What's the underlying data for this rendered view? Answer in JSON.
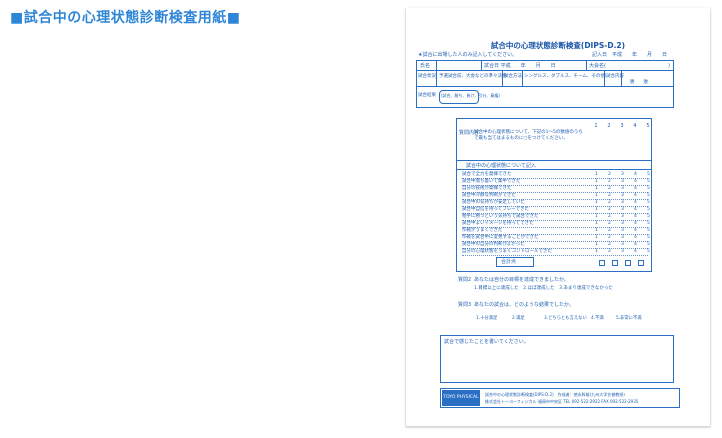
{
  "page": {
    "heading": "■試合中の心理状態診断検査用紙■"
  },
  "form": {
    "title": "試合中の心理状態診断検査(DIPS-D.2)",
    "instruction": "★試合に出場した人のみ記入してください。",
    "date_label": "記入日　平成　　年　　月　　日",
    "name_label": "氏名",
    "match_date_label": "試合日 平成　　年　　月　　日",
    "tournament_label": "大会名(",
    "tournament_close": ")",
    "situation_label": "試合状況",
    "situation_text": "予選試合前、大会などの準々決勝",
    "method_label": "試合方法",
    "method_text": "シングルス、ダブルス、チーム、その他(",
    "content_label": "試合内容",
    "content_text": "勝　　敗",
    "result_label": "試合結果",
    "result_text": "(試合、勝ち、負け、引分、棄権)",
    "scale_header": "質問内容",
    "scale_note": "試合中の心理状態について、下記の1〜5の数値のうちで最も当てはまるものに○をつけてください。",
    "scale_cols": [
      "1",
      "2",
      "3",
      "4",
      "5"
    ],
    "section_header": "試合中の心理状態について記入",
    "items": [
      "試合で全力を発揮できた",
      "試合中落ち着いて集中できた",
      "自分の技術が発揮できた",
      "試合中冷静な判断ができた",
      "試合中の気持ちが安定していた",
      "試合中自信を持ってプレーできた",
      "相手に勝つという気持ちで試合できた",
      "試合中よいイメージを持ってできた",
      "作戦がうまくできた",
      "作戦を試合中に変更することができた",
      "試合中の自分の判断がよかった",
      "自分の心理状態をうまくコントロールできた"
    ],
    "total_label": "合計点",
    "q2_label": "質問2",
    "q2_text": "あなたは自分の目標を達成できましたか。",
    "q2_options": "1.目標以上に達成した　2.ほぼ達成した　3.あまり達成できなかった",
    "q3_label": "質問3",
    "q3_text": "あなたの試合は、どのような結果でしたか。",
    "q3_options": [
      "1.十分満足",
      "2.満足",
      "3.どちらとも言えない",
      "4.不満",
      "5.非常に不満"
    ],
    "comment_label": "試合で感じたことを書いてください。",
    "footer_title": "試合中の心理状態診断検査(DIPS-D.2)　作成者：徳永幹雄(九州大学名誉教授)",
    "footer_publisher": "株式会社トーヨーフィジカル 福岡市中央区 TEL 092-522-2922 FAX 092-522-2935",
    "logo_text": "TOYO PHYSICAL"
  }
}
